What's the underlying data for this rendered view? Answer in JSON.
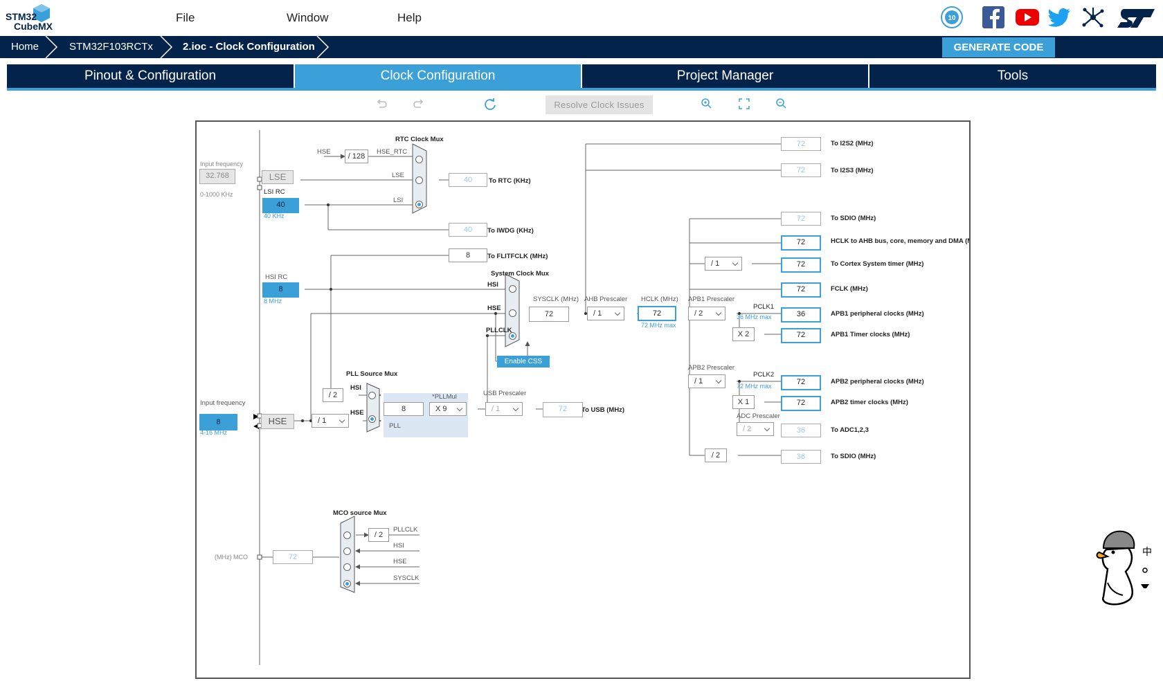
{
  "app": {
    "logo_line1": "STM32",
    "logo_line2": "CubeMX"
  },
  "menu": {
    "file": "File",
    "window": "Window",
    "help": "Help"
  },
  "breadcrumb": {
    "home": "Home",
    "device": "STM32F103RCTx",
    "file": "2.ioc - Clock Configuration"
  },
  "generate_label": "GENERATE CODE",
  "tabs": [
    "Pinout & Configuration",
    "Clock Configuration",
    "Project Manager",
    "Tools"
  ],
  "toolbar": {
    "resolve": "Resolve Clock Issues"
  },
  "colors": {
    "navy": "#03234b",
    "accent": "#3ca0d8"
  },
  "clock": {
    "rtc_mux_title": "RTC Clock Mux",
    "sys_mux_title": "System Clock Mux",
    "pll_mux_title": "PLL Source Mux",
    "mco_mux_title": "MCO source Mux",
    "input_freq_label": "Input frequency",
    "lse_freq": "32.768",
    "lse_range": "0-1000 KHz",
    "lse": "LSE",
    "lsi_rc": "LSI RC",
    "lsi_val": "40",
    "lsi_unit": "40 KHz",
    "hsi_rc": "HSI RC",
    "hsi_val": "8",
    "hsi_unit": "8 MHz",
    "hse_input_label": "Input frequency",
    "hse_freq": "8",
    "hse_range": "4-16 MHz",
    "hse": "HSE",
    "hse_div128": "/ 128",
    "hse_lbl": "HSE",
    "hse_rtc_lbl": "HSE_RTC",
    "lse_lbl": "LSE",
    "lsi_lbl": "LSI",
    "rtc_out": "40",
    "rtc_out_lbl": "To RTC (KHz)",
    "iwdg_out": "40",
    "iwdg_out_lbl": "To IWDG (KHz)",
    "flit_out": "8",
    "flit_out_lbl": "To FLITFCLK (MHz)",
    "hsi_in": "HSI",
    "hse_in": "HSE",
    "pllclk_in": "PLLCLK",
    "enable_css": "Enable CSS",
    "sysclk_lbl": "SYSCLK (MHz)",
    "sysclk": "72",
    "ahb_lbl": "AHB Prescaler",
    "ahb_sel": "/ 1",
    "hclk_lbl": "HCLK (MHz)",
    "hclk": "72",
    "hclk_max": "72 MHz max",
    "apb1_lbl": "APB1 Prescaler",
    "apb1_sel": "/ 2",
    "pclk1_lbl": "PCLK1",
    "pclk1_max": "36 MHz max",
    "apb1_timer_mul": "X 2",
    "apb2_lbl": "APB2 Prescaler",
    "apb2_sel": "/ 1",
    "pclk2_lbl": "PCLK2",
    "pclk2_max": "72 MHz max",
    "apb2_timer_mul": "X 1",
    "adc_lbl": "ADC Prescaler",
    "adc_sel": "/ 2",
    "sdio_div2": "/ 2",
    "cortex_sel": "/ 1",
    "pll_hsi_div": "/ 2",
    "pll_hse_sel": "/ 1",
    "pll_val": "8",
    "pllmul_lbl": "*PLLMul",
    "pllmul_sel": "X 9",
    "pll_lbl": "PLL",
    "usb_lbl": "USB Prescaler",
    "usb_sel": "/ 1",
    "usb_out": "72",
    "usb_out_lbl": "To USB (MHz)",
    "outputs": [
      {
        "value": "72",
        "label": "To I2S2 (MHz)"
      },
      {
        "value": "72",
        "label": "To I2S3 (MHz)"
      },
      {
        "value": "72",
        "label": "To SDIO (MHz)"
      },
      {
        "value": "72",
        "label": "HCLK to AHB bus, core, memory and DMA (MHz)"
      },
      {
        "value": "72",
        "label": "To Cortex System timer (MHz)"
      },
      {
        "value": "72",
        "label": "FCLK (MHz)"
      },
      {
        "value": "36",
        "label": "APB1 peripheral clocks (MHz)"
      },
      {
        "value": "72",
        "label": "APB1 Timer clocks (MHz)"
      },
      {
        "value": "72",
        "label": "APB2 peripheral clocks (MHz)"
      },
      {
        "value": "72",
        "label": "APB2 timer clocks (MHz)"
      },
      {
        "value": "36",
        "label": "To ADC1,2,3"
      },
      {
        "value": "36",
        "label": "To SDIO (MHz)"
      }
    ],
    "mco_lbl": "(MHz) MCO",
    "mco_val": "72",
    "mco_div2": "/ 2",
    "mco_pllclk": "PLLCLK",
    "mco_hsi": "HSI",
    "mco_hse": "HSE",
    "mco_sysclk": "SYSCLK"
  },
  "mascot_text": "中"
}
